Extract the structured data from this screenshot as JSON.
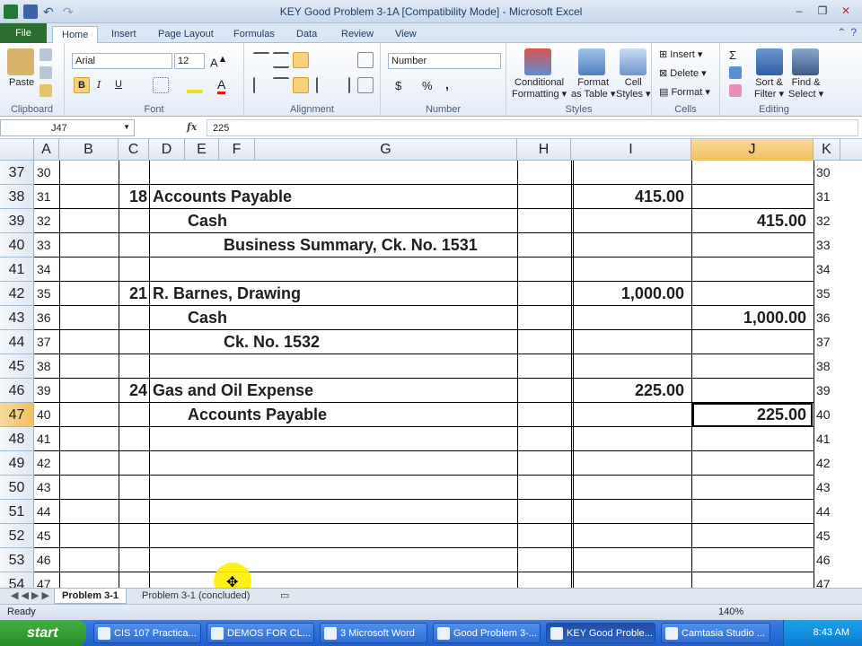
{
  "window": {
    "title": "KEY Good Problem 3-1A  [Compatibility Mode]  -  Microsoft Excel",
    "controls": [
      "–",
      "❐",
      "✕"
    ]
  },
  "ribbon_tabs": [
    "File",
    "Home",
    "Insert",
    "Page Layout",
    "Formulas",
    "Data",
    "Review",
    "View"
  ],
  "ribbon": {
    "clipboard": {
      "paste": "Paste",
      "label": "Clipboard"
    },
    "font": {
      "name": "Arial",
      "size": "12",
      "bold": "B",
      "italic": "I",
      "underline": "U",
      "label": "Font"
    },
    "alignment": {
      "label": "Alignment"
    },
    "number": {
      "format": "Number",
      "currency": "$",
      "percent": "%",
      "comma": ",",
      "label": "Number"
    },
    "styles": {
      "conditional": "Conditional",
      "formatting": "Formatting",
      "format_as": "Format",
      "as_table": "as Table",
      "cell": "Cell",
      "cell_styles": "Styles",
      "label": "Styles"
    },
    "cells": {
      "insert": "Insert",
      "delete": "Delete",
      "format": "Format",
      "label": "Cells"
    },
    "editing": {
      "sigma": "Σ",
      "sort": "Sort &",
      "filter": "Filter",
      "find": "Find &",
      "select": "Select",
      "label": "Editing"
    }
  },
  "formula_bar": {
    "name_box": "J47",
    "fx": "fx",
    "content": "225"
  },
  "columns": [
    "A",
    "B",
    "C",
    "D",
    "E",
    "F",
    "G",
    "H",
    "I",
    "J",
    "K"
  ],
  "rows": [
    {
      "row": "37",
      "n": "30",
      "c": "",
      "text": "",
      "debit": "",
      "credit": ""
    },
    {
      "row": "38",
      "n": "31",
      "c": "18",
      "text": "Accounts Payable",
      "debit": "415.00",
      "credit": ""
    },
    {
      "row": "39",
      "n": "32",
      "c": "",
      "text": "Cash",
      "debit": "",
      "credit": "415.00"
    },
    {
      "row": "40",
      "n": "33",
      "c": "",
      "text": "Business Summary, Ck. No. 1531",
      "debit": "",
      "credit": ""
    },
    {
      "row": "41",
      "n": "34",
      "c": "",
      "text": "",
      "debit": "",
      "credit": ""
    },
    {
      "row": "42",
      "n": "35",
      "c": "21",
      "text": "R. Barnes, Drawing",
      "debit": "1,000.00",
      "credit": ""
    },
    {
      "row": "43",
      "n": "36",
      "c": "",
      "text": "Cash",
      "debit": "",
      "credit": "1,000.00"
    },
    {
      "row": "44",
      "n": "37",
      "c": "",
      "text": "Ck. No. 1532",
      "debit": "",
      "credit": ""
    },
    {
      "row": "45",
      "n": "38",
      "c": "",
      "text": "",
      "debit": "",
      "credit": ""
    },
    {
      "row": "46",
      "n": "39",
      "c": "24",
      "text": "Gas and Oil Expense",
      "debit": "225.00",
      "credit": ""
    },
    {
      "row": "47",
      "n": "40",
      "c": "",
      "text": "Accounts Payable",
      "debit": "",
      "credit": "225.00"
    },
    {
      "row": "48",
      "n": "41",
      "c": "",
      "text": "",
      "debit": "",
      "credit": ""
    },
    {
      "row": "49",
      "n": "42",
      "c": "",
      "text": "",
      "debit": "",
      "credit": ""
    },
    {
      "row": "50",
      "n": "43",
      "c": "",
      "text": "",
      "debit": "",
      "credit": ""
    },
    {
      "row": "51",
      "n": "44",
      "c": "",
      "text": "",
      "debit": "",
      "credit": ""
    },
    {
      "row": "52",
      "n": "45",
      "c": "",
      "text": "",
      "debit": "",
      "credit": ""
    },
    {
      "row": "53",
      "n": "46",
      "c": "",
      "text": "",
      "debit": "",
      "credit": ""
    },
    {
      "row": "54",
      "n": "47",
      "c": "",
      "text": "",
      "debit": "",
      "credit": ""
    }
  ],
  "sheet_tabs": [
    "Problem 3-1",
    "Problem 3-1 (concluded)"
  ],
  "status": {
    "ready": "Ready",
    "zoom": "140%"
  },
  "taskbar": {
    "start": "start",
    "items": [
      "CIS 107 Practica...",
      "DEMOS FOR CL...",
      "3 Microsoft Word",
      "Good Problem 3-...",
      "KEY Good Proble...",
      "Camtasia Studio ..."
    ],
    "clock": "8:43 AM"
  },
  "colors": {
    "accent": "#2a6f2f",
    "selection": "#f1c15f"
  }
}
